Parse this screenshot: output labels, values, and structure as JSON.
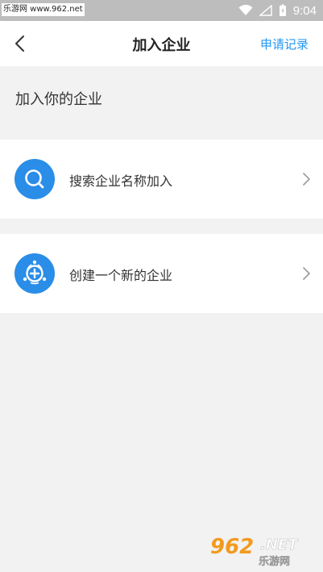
{
  "status_bar": {
    "left_text": "乐游网 www.962.net",
    "time": "9:04"
  },
  "nav": {
    "title": "加入企业",
    "action_label": "申请记录"
  },
  "section": {
    "title": "加入你的企业"
  },
  "rows": [
    {
      "label": "搜索企业名称加入",
      "icon": "search-icon"
    },
    {
      "label": "创建一个新的企业",
      "icon": "create-enterprise-icon"
    }
  ],
  "watermark": {
    "number": "962",
    "net": ".NET",
    "site": "乐游网"
  },
  "colors": {
    "accent": "#2196f3",
    "icon_bg": "#2a8de8",
    "background": "#f2f2f2"
  }
}
